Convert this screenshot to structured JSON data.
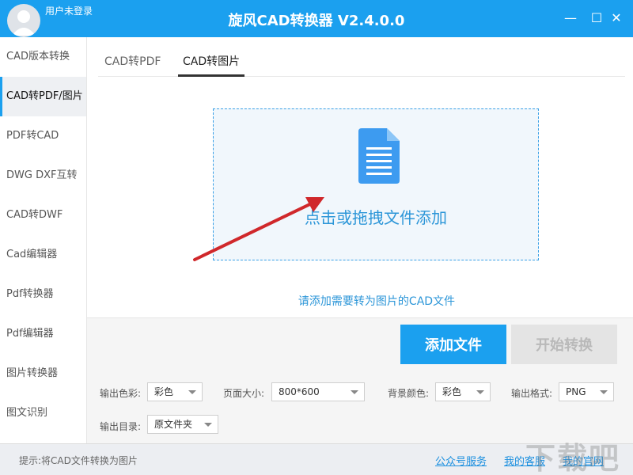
{
  "titlebar": {
    "user_label": "用户未登录",
    "app_title": "旋风CAD转换器 V2.4.0.0",
    "min_glyph": "—",
    "max_glyph": "☐",
    "close_glyph": "✕"
  },
  "sidebar": {
    "items": [
      {
        "label": "CAD版本转换"
      },
      {
        "label": "CAD转PDF/图片"
      },
      {
        "label": "PDF转CAD"
      },
      {
        "label": "DWG DXF互转"
      },
      {
        "label": "CAD转DWF"
      },
      {
        "label": "Cad编辑器"
      },
      {
        "label": "Pdf转换器"
      },
      {
        "label": "Pdf编辑器"
      },
      {
        "label": "图片转换器"
      },
      {
        "label": "图文识别"
      }
    ],
    "active_index": 1
  },
  "tabs": [
    {
      "label": "CAD转PDF"
    },
    {
      "label": "CAD转图片"
    }
  ],
  "dropzone": {
    "text": "点击或拖拽文件添加"
  },
  "hint": "请添加需要转为图片的CAD文件",
  "buttons": {
    "add_file": "添加文件",
    "start_convert": "开始转换"
  },
  "options": {
    "color": {
      "label": "输出色彩:",
      "value": "彩色"
    },
    "page_size": {
      "label": "页面大小:",
      "value": "800*600"
    },
    "bg_color": {
      "label": "背景颜色:",
      "value": "彩色"
    },
    "format": {
      "label": "输出格式:",
      "value": "PNG"
    },
    "output_dir": {
      "label": "输出目录:",
      "value": "原文件夹"
    }
  },
  "statusbar": {
    "tip": "提示:将CAD文件转换为图片",
    "link_official": "公众号服务",
    "link_service": "我的客服",
    "link_site": "我的官网"
  },
  "watermark": "下载吧",
  "colors": {
    "accent": "#1ba0ef",
    "link": "#1b8fdf",
    "arrow": "#d0282b"
  }
}
